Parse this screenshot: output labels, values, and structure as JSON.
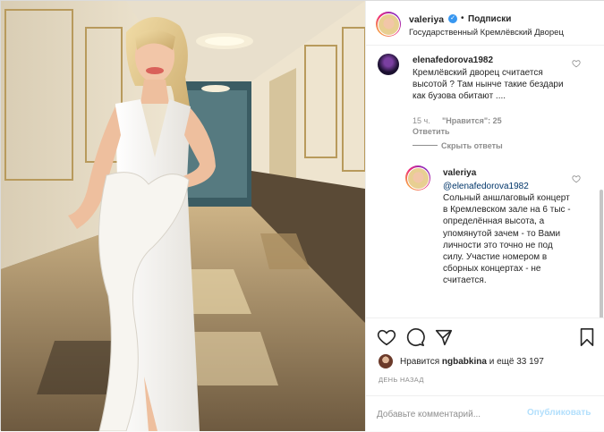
{
  "header": {
    "username": "valeriya",
    "dot": "•",
    "follow_label": "Подписки",
    "location": "Государственный Кремлёвский Дворец"
  },
  "comments": [
    {
      "username": "elenafedorova1982",
      "text": "Кремлёвский дворец считается высотой ? Там нынче такие бездари как бузова обитают ....",
      "time": "15 ч.",
      "likes": "\"Нравится\": 25",
      "reply_label": "Ответить",
      "hide_replies_label": "Скрыть ответы"
    },
    {
      "username": "valeriya",
      "mention": "@elenafedorova1982",
      "text": "Сольный аншлаговый концерт в Кремлевском зале на 6 тыс - определённая высота, а упомянутой зачем - то Вами личности это точно не под силу. Участие номером в сборных концертах - не считается."
    }
  ],
  "likes": {
    "prefix": "Нравится",
    "user": "ngbabkina",
    "suffix": "и ещё 33 197"
  },
  "date": "ДЕНЬ НАЗАД",
  "add_comment": {
    "placeholder": "Добавьте комментарий...",
    "publish_label": "Опубликовать"
  },
  "colors": {
    "accent": "#3897f0",
    "publish_disabled": "#b2dffc",
    "mention": "#003569"
  },
  "icons": [
    "heart-icon",
    "comment-icon",
    "share-icon",
    "bookmark-icon",
    "verified-badge-icon"
  ]
}
